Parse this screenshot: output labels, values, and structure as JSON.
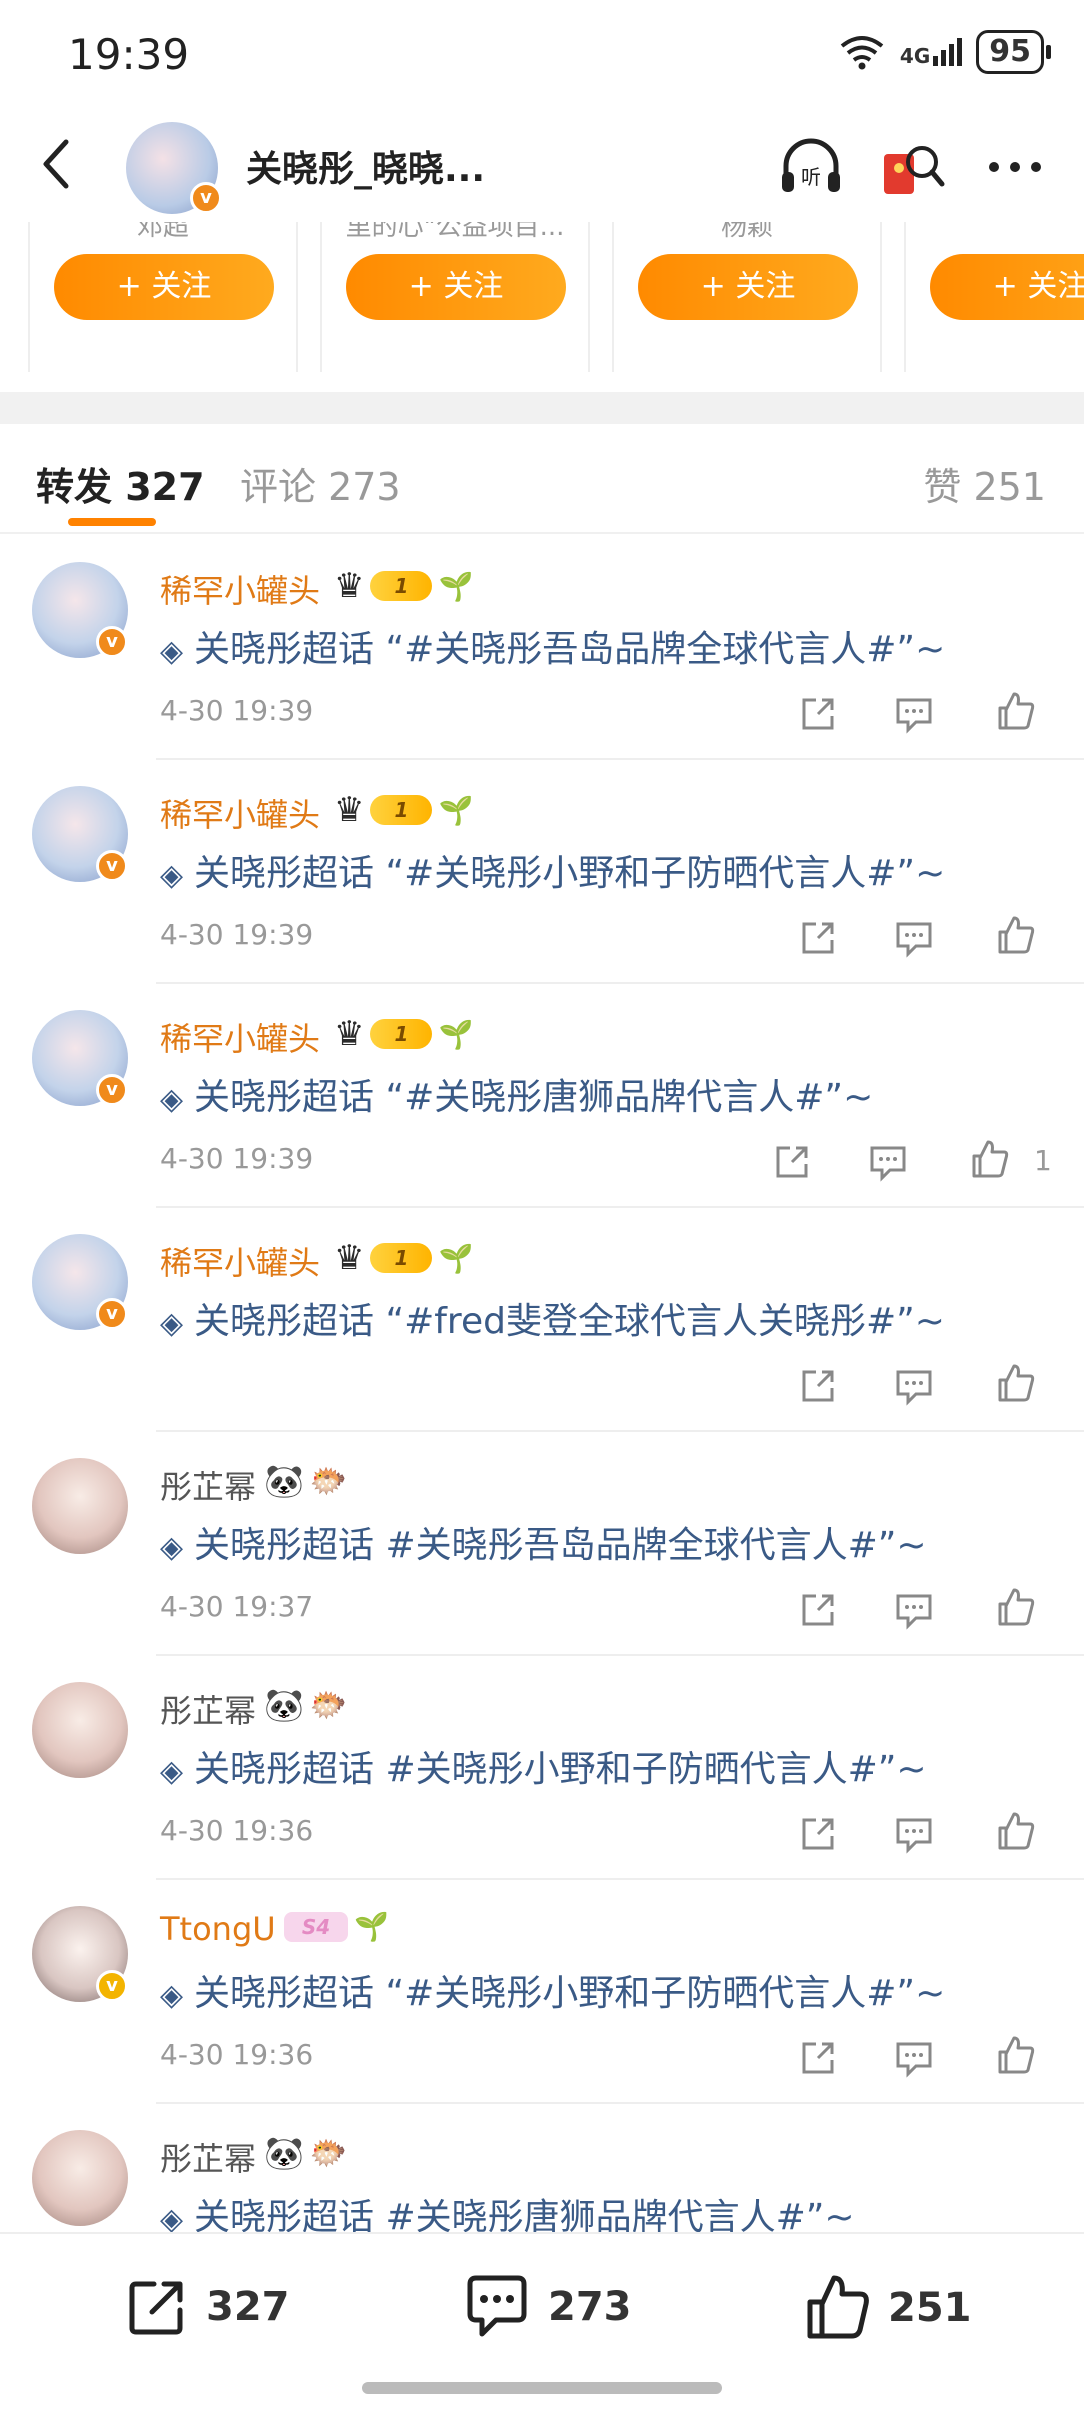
{
  "status": {
    "time": "19:39",
    "network": "4G",
    "battery": "95"
  },
  "header": {
    "title": "关晓彤_晓晓...",
    "listen_icon_label": "听"
  },
  "recommend": [
    {
      "name": "邓超",
      "follow_label": "+ 关注"
    },
    {
      "name": "里的心\"公益项目...",
      "follow_label": "+ 关注"
    },
    {
      "name": "杨颖",
      "follow_label": "+ 关注"
    },
    {
      "name": "",
      "follow_label": "+ 关注"
    }
  ],
  "tabs": {
    "repost": "转发 327",
    "comment": "评论 273",
    "like": "赞 251"
  },
  "items": [
    {
      "user": "稀罕小罐头",
      "level": "1",
      "content": "关晓彤超话 “#关晓彤吾岛品牌全球代言人#”~",
      "time": "4-30 19:39",
      "likes": ""
    },
    {
      "user": "稀罕小罐头",
      "level": "1",
      "content": "关晓彤超话 “#关晓彤小野和子防晒代言人#”~",
      "time": "4-30 19:39",
      "likes": ""
    },
    {
      "user": "稀罕小罐头",
      "level": "1",
      "content": "关晓彤超话 “#关晓彤唐狮品牌代言人#”~",
      "time": "4-30 19:39",
      "likes": "1"
    },
    {
      "user": "稀罕小罐头",
      "level": "1",
      "content": "关晓彤超话 “#fred斐登全球代言人关晓彤#”~",
      "time": "",
      "likes": ""
    },
    {
      "user": "彤芷幂",
      "level": "",
      "content": "关晓彤超话 #关晓彤吾岛品牌全球代言人#”~",
      "time": "4-30 19:37",
      "likes": ""
    },
    {
      "user": "彤芷幂",
      "level": "",
      "content": "关晓彤超话 #关晓彤小野和子防晒代言人#”~",
      "time": "4-30 19:36",
      "likes": ""
    },
    {
      "user": "TtongU",
      "level": "S4",
      "content": "关晓彤超话 “#关晓彤小野和子防晒代言人#”~",
      "time": "4-30 19:36",
      "likes": ""
    },
    {
      "user": "彤芷幂",
      "level": "",
      "content": "关晓彤超话 #关晓彤唐狮品牌代言人#”~",
      "time": "",
      "likes": ""
    }
  ],
  "bottom": {
    "repost": "327",
    "comment": "273",
    "like": "251"
  },
  "colors": {
    "accent": "#ff8200",
    "link": "#3a5a86",
    "username": "#e07a16"
  }
}
